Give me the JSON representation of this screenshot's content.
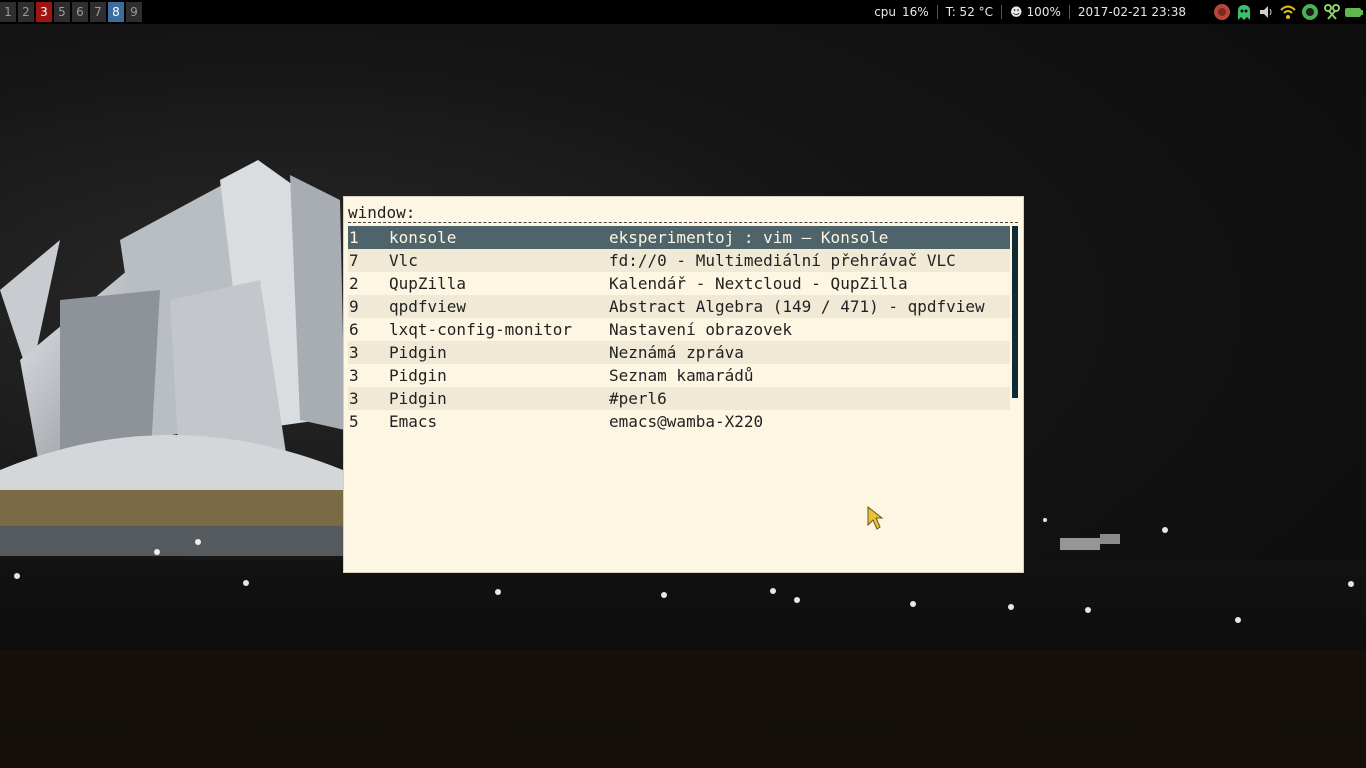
{
  "panel": {
    "workspaces": [
      {
        "label": "1",
        "state": "normal"
      },
      {
        "label": "2",
        "state": "normal"
      },
      {
        "label": "3",
        "state": "urgent"
      },
      {
        "label": "5",
        "state": "normal"
      },
      {
        "label": "6",
        "state": "normal"
      },
      {
        "label": "7",
        "state": "normal"
      },
      {
        "label": "8",
        "state": "active"
      },
      {
        "label": "9",
        "state": "normal"
      }
    ],
    "status": {
      "cpu_label": "cpu",
      "cpu_value": "16%",
      "temp": "T: 52 °C",
      "brightness_icon": "☻",
      "brightness": "100%",
      "datetime": "2017-02-21 23:38"
    },
    "tray_icons": [
      "power-icon",
      "ghost-icon",
      "volume-icon",
      "wifi-icon",
      "network-icon",
      "scissors-icon",
      "battery-icon"
    ]
  },
  "switcher": {
    "prompt": "window:",
    "rows": [
      {
        "ws": "1",
        "class": "konsole",
        "title": "eksperimentoj : vim — Konsole"
      },
      {
        "ws": "7",
        "class": "Vlc",
        "title": "fd://0 - Multimediální přehrávač VLC"
      },
      {
        "ws": "2",
        "class": "QupZilla",
        "title": "Kalendář - Nextcloud - QupZilla"
      },
      {
        "ws": "9",
        "class": "qpdfview",
        "title": "Abstract Algebra (149 / 471) - qpdfview"
      },
      {
        "ws": "6",
        "class": "lxqt-config-monitor",
        "title": "Nastavení obrazovek"
      },
      {
        "ws": "3",
        "class": "Pidgin",
        "title": "Neznámá zpráva"
      },
      {
        "ws": "3",
        "class": "Pidgin",
        "title": "Seznam kamarádů"
      },
      {
        "ws": "3",
        "class": "Pidgin",
        "title": "#perl6"
      },
      {
        "ws": "5",
        "class": "Emacs",
        "title": "emacs@wamba-X220"
      }
    ],
    "selected_index": 0,
    "colors": {
      "selected_bg": "#4f636b",
      "background": "#fdf6e3",
      "alt_row": "#f0e9d6"
    }
  }
}
